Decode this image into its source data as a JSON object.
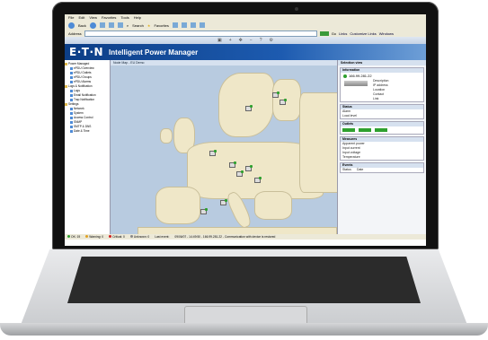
{
  "browser": {
    "menu": [
      "File",
      "Edit",
      "View",
      "Favorites",
      "Tools",
      "Help"
    ],
    "toolbar": {
      "back": "Back",
      "search": "Search",
      "favorites": "Favorites"
    },
    "address_label": "Address",
    "go_label": "Go",
    "links": [
      "Links",
      "Customize Links",
      "Windows"
    ]
  },
  "app": {
    "logo": "E·T·N",
    "title": "Intelligent Power Manager"
  },
  "tree": {
    "items": [
      {
        "label": "Power Managed",
        "level": 0
      },
      {
        "label": "ePDU Overview",
        "level": 1
      },
      {
        "label": "ePDU Outlets",
        "level": 1
      },
      {
        "label": "ePDU Groups",
        "level": 1
      },
      {
        "label": "ePDU Alarms",
        "level": 1
      },
      {
        "label": "Logs & Notification",
        "level": 0
      },
      {
        "label": "Logs",
        "level": 1
      },
      {
        "label": "Email Notification",
        "level": 1
      },
      {
        "label": "Trap Notification",
        "level": 1
      },
      {
        "label": "Settings",
        "level": 0
      },
      {
        "label": "Network",
        "level": 1
      },
      {
        "label": "System",
        "level": 1
      },
      {
        "label": "Access Control",
        "level": 1
      },
      {
        "label": "SNMP",
        "level": 1
      },
      {
        "label": "SMTP & DNS",
        "level": 1
      },
      {
        "label": "Date & Time",
        "level": 1
      }
    ]
  },
  "map": {
    "header": "Node Map - EU Demo"
  },
  "panel": {
    "header": "Selection view",
    "information_title": "Information",
    "ip": "166.99.281.22",
    "info_fields": [
      "Description",
      "IP address",
      "Location",
      "Contact",
      "Link"
    ],
    "status_title": "Status",
    "status_fields": [
      "Alarm",
      "Load level"
    ],
    "outlets_title": "Outlets",
    "measures_title": "Measures",
    "measure_fields": [
      "Apparent power",
      "Input current",
      "Input voltage",
      "Temperature"
    ],
    "events_title": "Events",
    "events_cols": [
      "Status",
      "Date"
    ]
  },
  "statusbar": {
    "ok": "OK: 19",
    "warning": "Warning: 0",
    "critical": "Critical: 0",
    "unknown": "Unknown: 0",
    "last_event": "Last event:",
    "event_text": "09/06/07 - 14:49:50 - 166.99.281.22 - Communication with device is restored"
  },
  "colors": {
    "banner": "#0c3e86",
    "ok": "#2ea02e",
    "warning": "#e0a020",
    "critical": "#d02020",
    "unknown": "#888888"
  }
}
